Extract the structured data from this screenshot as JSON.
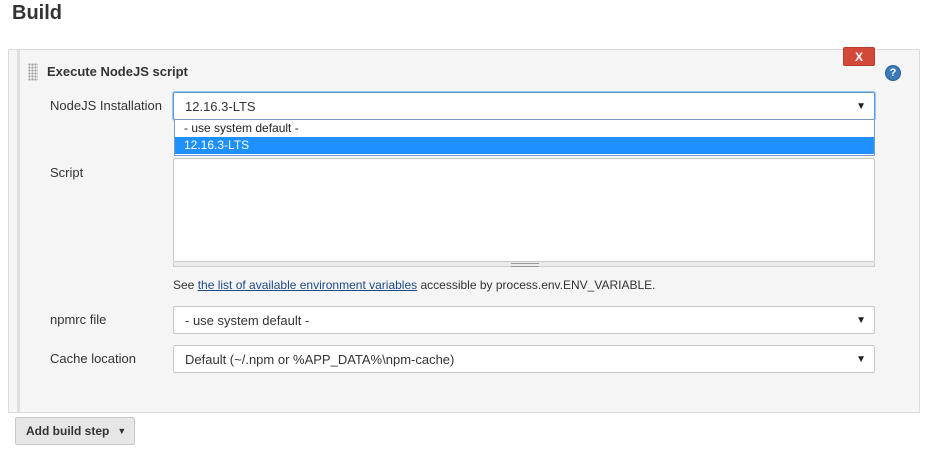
{
  "section": {
    "title": "Build"
  },
  "step": {
    "title": "Execute NodeJS script",
    "delete_label": "X",
    "help_label": "?"
  },
  "fields": {
    "nodejs_installation": {
      "label": "NodeJS Installation",
      "value": "12.16.3-LTS",
      "options": [
        "- use system default -",
        "12.16.3-LTS"
      ],
      "selected_index": 1
    },
    "script": {
      "label": "Script",
      "value": ""
    },
    "npmrc": {
      "label": "npmrc file",
      "value": "- use system default -"
    },
    "cache": {
      "label": "Cache location",
      "value": "Default (~/.npm or %APP_DATA%\\npm-cache)"
    }
  },
  "env_help": {
    "prefix": "See ",
    "link_text": "the list of available environment variables",
    "suffix": " accessible by process.env.ENV_VARIABLE."
  },
  "add_build_step": {
    "label": "Add build step"
  },
  "colors": {
    "delete_button": "#d24939",
    "help_icon": "#3b79b8",
    "selected_option": "#1e90ff",
    "link": "#204a87"
  }
}
